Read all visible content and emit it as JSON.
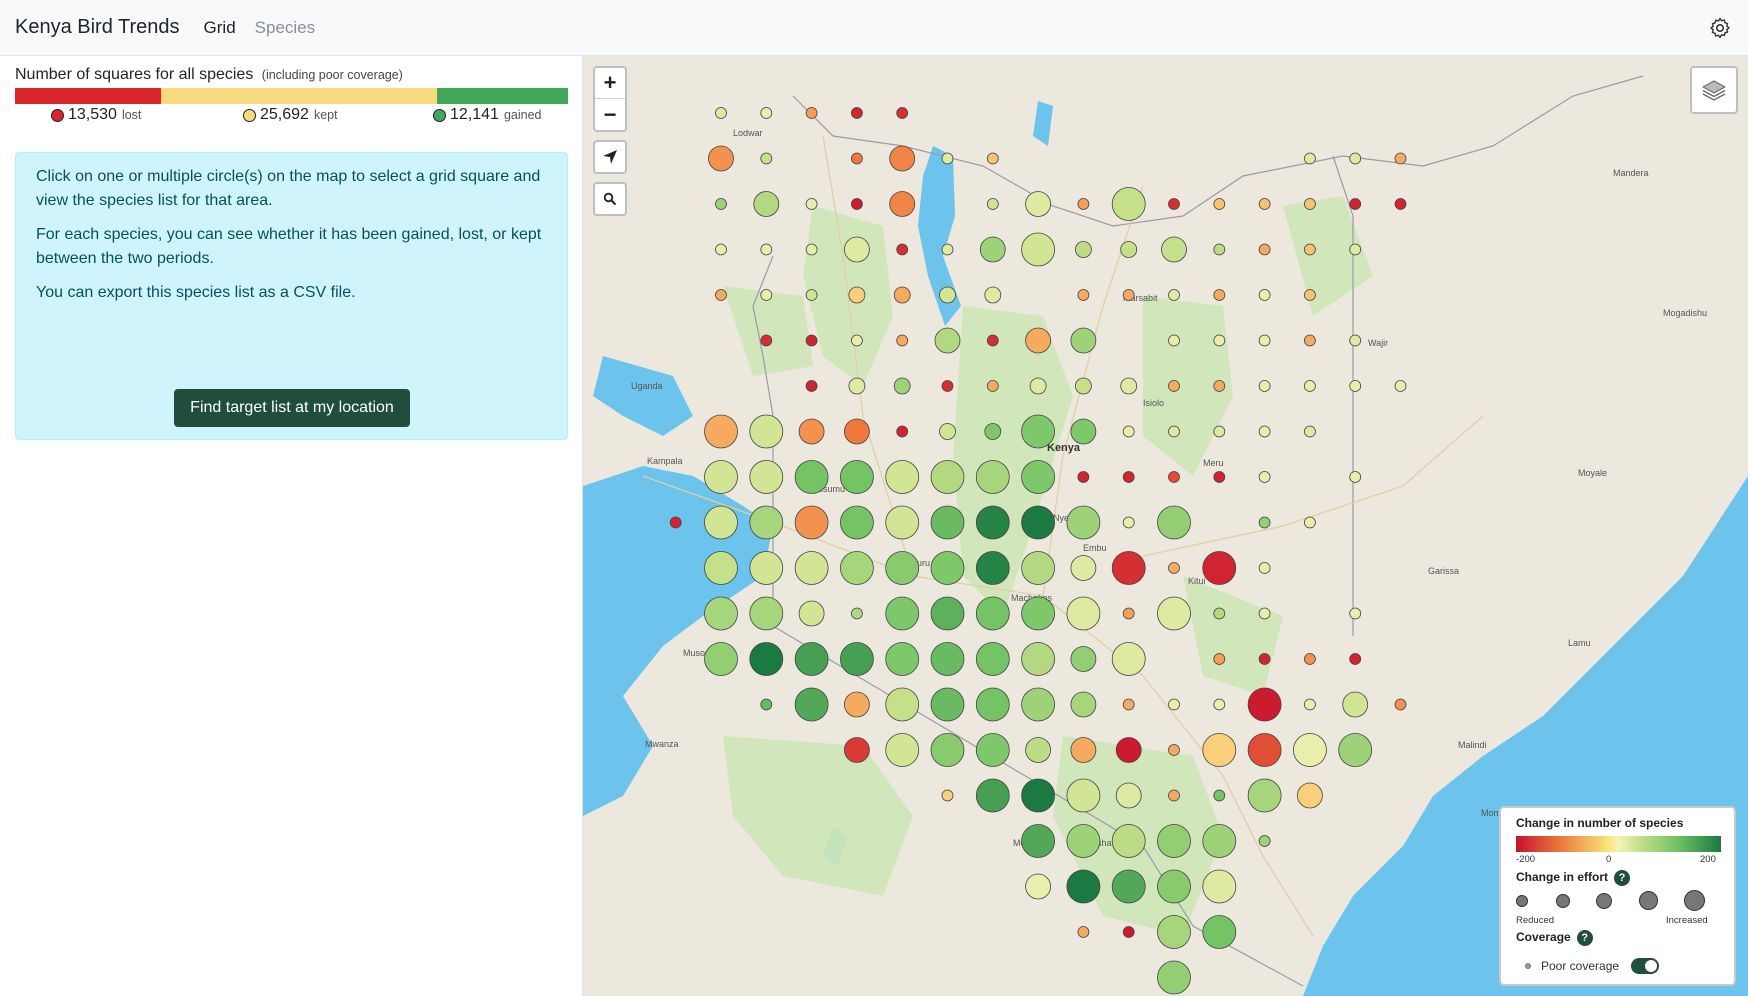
{
  "app": {
    "title": "Kenya Bird Trends"
  },
  "nav": {
    "grid": "Grid",
    "species": "Species"
  },
  "summary": {
    "title": "Number of squares for all species",
    "note": "(including poor coverage)",
    "lost": {
      "value": "13,530",
      "label": "lost",
      "color": "#d7262c"
    },
    "kept": {
      "value": "25,692",
      "label": "kept",
      "color": "#f9da7d"
    },
    "gained": {
      "value": "12,141",
      "label": "gained",
      "color": "#41a85a"
    }
  },
  "info": {
    "p1": "Click on one or multiple circle(s) on the map to select a grid square and view the species list for that area.",
    "p2": "For each species, you can see whether it has been gained, lost, or kept between the two periods.",
    "p3": "You can export this species list as a CSV file.",
    "button": "Find target list at my location"
  },
  "map_controls": {
    "zoom_in": "+",
    "zoom_out": "−"
  },
  "map_labels": {
    "country": "Kenya",
    "places": [
      "Uganda",
      "Kampala",
      "Lodwar",
      "Marsabit",
      "Wajir",
      "Garissa",
      "Mombasa",
      "Malindi",
      "Lamu",
      "Kisumu",
      "Nakuru",
      "Nyeri",
      "Embu",
      "Kitui",
      "Machakos",
      "Arusha",
      "Moshi",
      "Mwanza",
      "Musoma",
      "Moyale",
      "Mandera",
      "Isiolo",
      "Meru",
      "Mogadishu"
    ]
  },
  "legend": {
    "title_change": "Change in number of species",
    "scale_min": "-200",
    "scale_mid": "0",
    "scale_max": "200",
    "title_effort": "Change in effort",
    "effort_low": "Reduced",
    "effort_high": "Increased",
    "title_coverage": "Coverage",
    "poor_coverage": "Poor coverage",
    "help": "?"
  },
  "grid_points": [
    {
      "col": 0,
      "row": 0,
      "v": 20,
      "s": 1
    },
    {
      "col": 1,
      "row": 0,
      "v": 10,
      "s": 1
    },
    {
      "col": 2,
      "row": 0,
      "v": -70,
      "s": 1
    },
    {
      "col": 3,
      "row": 0,
      "v": -180,
      "s": 1
    },
    {
      "col": 4,
      "row": 0,
      "v": -170,
      "s": 1
    },
    {
      "col": 0,
      "row": 1,
      "v": -80,
      "s": 3
    },
    {
      "col": 1,
      "row": 1,
      "v": 40,
      "s": 1
    },
    {
      "col": 3,
      "row": 1,
      "v": -100,
      "s": 1
    },
    {
      "col": 4,
      "row": 1,
      "v": -90,
      "s": 3
    },
    {
      "col": 5,
      "row": 1,
      "v": 20,
      "s": 1
    },
    {
      "col": 6,
      "row": 1,
      "v": -40,
      "s": 1
    },
    {
      "col": 13,
      "row": 1,
      "v": 20,
      "s": 1
    },
    {
      "col": 14,
      "row": 1,
      "v": 20,
      "s": 1
    },
    {
      "col": 15,
      "row": 1,
      "v": -60,
      "s": 1
    },
    {
      "col": 0,
      "row": 2,
      "v": 80,
      "s": 1
    },
    {
      "col": 1,
      "row": 2,
      "v": 60,
      "s": 3
    },
    {
      "col": 2,
      "row": 2,
      "v": 10,
      "s": 1
    },
    {
      "col": 3,
      "row": 2,
      "v": -190,
      "s": 1
    },
    {
      "col": 4,
      "row": 2,
      "v": -90,
      "s": 3
    },
    {
      "col": 6,
      "row": 2,
      "v": 30,
      "s": 1
    },
    {
      "col": 7,
      "row": 2,
      "v": 20,
      "s": 3
    },
    {
      "col": 8,
      "row": 2,
      "v": -70,
      "s": 1
    },
    {
      "col": 9,
      "row": 2,
      "v": 40,
      "s": 4
    },
    {
      "col": 10,
      "row": 2,
      "v": -170,
      "s": 1
    },
    {
      "col": 11,
      "row": 2,
      "v": -40,
      "s": 1
    },
    {
      "col": 12,
      "row": 2,
      "v": -40,
      "s": 1
    },
    {
      "col": 13,
      "row": 2,
      "v": -40,
      "s": 1
    },
    {
      "col": 14,
      "row": 2,
      "v": -180,
      "s": 1
    },
    {
      "col": 15,
      "row": 2,
      "v": -180,
      "s": 1
    },
    {
      "col": 0,
      "row": 3,
      "v": 10,
      "s": 1
    },
    {
      "col": 1,
      "row": 3,
      "v": 10,
      "s": 1
    },
    {
      "col": 2,
      "row": 3,
      "v": 10,
      "s": 1
    },
    {
      "col": 3,
      "row": 3,
      "v": 20,
      "s": 3
    },
    {
      "col": 4,
      "row": 3,
      "v": -170,
      "s": 1
    },
    {
      "col": 5,
      "row": 3,
      "v": 20,
      "s": 1
    },
    {
      "col": 6,
      "row": 3,
      "v": 80,
      "s": 3
    },
    {
      "col": 7,
      "row": 3,
      "v": 30,
      "s": 4
    },
    {
      "col": 8,
      "row": 3,
      "v": 50,
      "s": 2
    },
    {
      "col": 9,
      "row": 3,
      "v": 40,
      "s": 2
    },
    {
      "col": 10,
      "row": 3,
      "v": 40,
      "s": 3
    },
    {
      "col": 11,
      "row": 3,
      "v": 50,
      "s": 1
    },
    {
      "col": 12,
      "row": 3,
      "v": -60,
      "s": 1
    },
    {
      "col": 13,
      "row": 3,
      "v": -40,
      "s": 1
    },
    {
      "col": 14,
      "row": 3,
      "v": 20,
      "s": 1
    },
    {
      "col": 0,
      "row": 4,
      "v": -60,
      "s": 1
    },
    {
      "col": 1,
      "row": 4,
      "v": 10,
      "s": 1
    },
    {
      "col": 2,
      "row": 4,
      "v": 30,
      "s": 1
    },
    {
      "col": 3,
      "row": 4,
      "v": -30,
      "s": 2
    },
    {
      "col": 4,
      "row": 4,
      "v": -60,
      "s": 2
    },
    {
      "col": 5,
      "row": 4,
      "v": 30,
      "s": 2
    },
    {
      "col": 6,
      "row": 4,
      "v": 20,
      "s": 2
    },
    {
      "col": 8,
      "row": 4,
      "v": -60,
      "s": 1
    },
    {
      "col": 9,
      "row": 4,
      "v": -60,
      "s": 1
    },
    {
      "col": 10,
      "row": 4,
      "v": 20,
      "s": 1
    },
    {
      "col": 11,
      "row": 4,
      "v": -60,
      "s": 1
    },
    {
      "col": 12,
      "row": 4,
      "v": 10,
      "s": 1
    },
    {
      "col": 13,
      "row": 4,
      "v": -40,
      "s": 1
    },
    {
      "col": 1,
      "row": 5,
      "v": -170,
      "s": 1
    },
    {
      "col": 2,
      "row": 5,
      "v": -180,
      "s": 1
    },
    {
      "col": 3,
      "row": 5,
      "v": 10,
      "s": 1
    },
    {
      "col": 4,
      "row": 5,
      "v": -60,
      "s": 1
    },
    {
      "col": 5,
      "row": 5,
      "v": 60,
      "s": 3
    },
    {
      "col": 6,
      "row": 5,
      "v": -170,
      "s": 1
    },
    {
      "col": 7,
      "row": 5,
      "v": -60,
      "s": 3
    },
    {
      "col": 8,
      "row": 5,
      "v": 80,
      "s": 3
    },
    {
      "col": 10,
      "row": 5,
      "v": 10,
      "s": 1
    },
    {
      "col": 11,
      "row": 5,
      "v": 10,
      "s": 1
    },
    {
      "col": 12,
      "row": 5,
      "v": 10,
      "s": 1
    },
    {
      "col": 13,
      "row": 5,
      "v": -60,
      "s": 1
    },
    {
      "col": 14,
      "row": 5,
      "v": 20,
      "s": 1
    },
    {
      "col": 2,
      "row": 6,
      "v": -180,
      "s": 1
    },
    {
      "col": 3,
      "row": 6,
      "v": 20,
      "s": 2
    },
    {
      "col": 4,
      "row": 6,
      "v": 80,
      "s": 2
    },
    {
      "col": 5,
      "row": 6,
      "v": -170,
      "s": 1
    },
    {
      "col": 6,
      "row": 6,
      "v": -60,
      "s": 1
    },
    {
      "col": 7,
      "row": 6,
      "v": 20,
      "s": 2
    },
    {
      "col": 8,
      "row": 6,
      "v": 40,
      "s": 2
    },
    {
      "col": 9,
      "row": 6,
      "v": 20,
      "s": 2
    },
    {
      "col": 10,
      "row": 6,
      "v": -60,
      "s": 1
    },
    {
      "col": 11,
      "row": 6,
      "v": -60,
      "s": 1
    },
    {
      "col": 12,
      "row": 6,
      "v": 10,
      "s": 1
    },
    {
      "col": 13,
      "row": 6,
      "v": 10,
      "s": 1
    },
    {
      "col": 14,
      "row": 6,
      "v": 10,
      "s": 1
    },
    {
      "col": 15,
      "row": 6,
      "v": 10,
      "s": 1
    },
    {
      "col": 0,
      "row": 7,
      "v": -60,
      "s": 4
    },
    {
      "col": 1,
      "row": 7,
      "v": 30,
      "s": 4
    },
    {
      "col": 2,
      "row": 7,
      "v": -80,
      "s": 3
    },
    {
      "col": 3,
      "row": 7,
      "v": -100,
      "s": 3
    },
    {
      "col": 4,
      "row": 7,
      "v": -180,
      "s": 1
    },
    {
      "col": 5,
      "row": 7,
      "v": 30,
      "s": 2
    },
    {
      "col": 6,
      "row": 7,
      "v": 110,
      "s": 2
    },
    {
      "col": 7,
      "row": 7,
      "v": 110,
      "s": 4
    },
    {
      "col": 8,
      "row": 7,
      "v": 110,
      "s": 3
    },
    {
      "col": 9,
      "row": 7,
      "v": 10,
      "s": 1
    },
    {
      "col": 10,
      "row": 7,
      "v": 20,
      "s": 1
    },
    {
      "col": 11,
      "row": 7,
      "v": 20,
      "s": 1
    },
    {
      "col": 12,
      "row": 7,
      "v": 10,
      "s": 1
    },
    {
      "col": 13,
      "row": 7,
      "v": 20,
      "s": 1
    },
    {
      "col": 0,
      "row": 8,
      "v": 30,
      "s": 4
    },
    {
      "col": 1,
      "row": 8,
      "v": 30,
      "s": 4
    },
    {
      "col": 2,
      "row": 8,
      "v": 120,
      "s": 4
    },
    {
      "col": 3,
      "row": 8,
      "v": 120,
      "s": 4
    },
    {
      "col": 4,
      "row": 8,
      "v": 30,
      "s": 4
    },
    {
      "col": 5,
      "row": 8,
      "v": 60,
      "s": 4
    },
    {
      "col": 6,
      "row": 8,
      "v": 70,
      "s": 4
    },
    {
      "col": 7,
      "row": 8,
      "v": 110,
      "s": 4
    },
    {
      "col": 8,
      "row": 8,
      "v": -180,
      "s": 1
    },
    {
      "col": 9,
      "row": 8,
      "v": -180,
      "s": 1
    },
    {
      "col": 10,
      "row": 8,
      "v": -140,
      "s": 1
    },
    {
      "col": 11,
      "row": 8,
      "v": -180,
      "s": 1
    },
    {
      "col": 12,
      "row": 8,
      "v": 10,
      "s": 1
    },
    {
      "col": 14,
      "row": 8,
      "v": 10,
      "s": 1
    },
    {
      "col": -1,
      "row": 9,
      "v": -180,
      "s": 1
    },
    {
      "col": 0,
      "row": 9,
      "v": 30,
      "s": 4
    },
    {
      "col": 1,
      "row": 9,
      "v": 70,
      "s": 4
    },
    {
      "col": 2,
      "row": 9,
      "v": -80,
      "s": 4
    },
    {
      "col": 3,
      "row": 9,
      "v": 120,
      "s": 4
    },
    {
      "col": 4,
      "row": 9,
      "v": 30,
      "s": 4
    },
    {
      "col": 5,
      "row": 9,
      "v": 130,
      "s": 4
    },
    {
      "col": 6,
      "row": 9,
      "v": 190,
      "s": 4
    },
    {
      "col": 7,
      "row": 9,
      "v": 200,
      "s": 4
    },
    {
      "col": 8,
      "row": 9,
      "v": 80,
      "s": 4
    },
    {
      "col": 9,
      "row": 9,
      "v": 10,
      "s": 1
    },
    {
      "col": 10,
      "row": 9,
      "v": 90,
      "s": 4
    },
    {
      "col": 12,
      "row": 9,
      "v": 90,
      "s": 1
    },
    {
      "col": 13,
      "row": 9,
      "v": 10,
      "s": 1
    },
    {
      "col": 0,
      "row": 10,
      "v": 40,
      "s": 4
    },
    {
      "col": 1,
      "row": 10,
      "v": 30,
      "s": 4
    },
    {
      "col": 2,
      "row": 10,
      "v": 30,
      "s": 4
    },
    {
      "col": 3,
      "row": 10,
      "v": 70,
      "s": 4
    },
    {
      "col": 4,
      "row": 10,
      "v": 100,
      "s": 4
    },
    {
      "col": 5,
      "row": 10,
      "v": 110,
      "s": 4
    },
    {
      "col": 6,
      "row": 10,
      "v": 190,
      "s": 4
    },
    {
      "col": 7,
      "row": 10,
      "v": 60,
      "s": 4
    },
    {
      "col": 8,
      "row": 10,
      "v": 20,
      "s": 3
    },
    {
      "col": 9,
      "row": 10,
      "v": -170,
      "s": 4
    },
    {
      "col": 10,
      "row": 10,
      "v": -60,
      "s": 1
    },
    {
      "col": 11,
      "row": 10,
      "v": -180,
      "s": 4
    },
    {
      "col": 12,
      "row": 10,
      "v": 10,
      "s": 1
    },
    {
      "col": 0,
      "row": 11,
      "v": 70,
      "s": 4
    },
    {
      "col": 1,
      "row": 11,
      "v": 70,
      "s": 4
    },
    {
      "col": 2,
      "row": 11,
      "v": 30,
      "s": 3
    },
    {
      "col": 3,
      "row": 11,
      "v": 60,
      "s": 1
    },
    {
      "col": 4,
      "row": 11,
      "v": 110,
      "s": 4
    },
    {
      "col": 5,
      "row": 11,
      "v": 140,
      "s": 4
    },
    {
      "col": 6,
      "row": 11,
      "v": 120,
      "s": 4
    },
    {
      "col": 7,
      "row": 11,
      "v": 110,
      "s": 4
    },
    {
      "col": 8,
      "row": 11,
      "v": 20,
      "s": 4
    },
    {
      "col": 9,
      "row": 11,
      "v": -70,
      "s": 1
    },
    {
      "col": 10,
      "row": 11,
      "v": 20,
      "s": 4
    },
    {
      "col": 11,
      "row": 11,
      "v": 60,
      "s": 1
    },
    {
      "col": 12,
      "row": 11,
      "v": 10,
      "s": 1
    },
    {
      "col": 14,
      "row": 11,
      "v": 10,
      "s": 1
    },
    {
      "col": 0,
      "row": 12,
      "v": 90,
      "s": 4
    },
    {
      "col": 1,
      "row": 12,
      "v": 200,
      "s": 4
    },
    {
      "col": 2,
      "row": 12,
      "v": 160,
      "s": 4
    },
    {
      "col": 3,
      "row": 12,
      "v": 160,
      "s": 4
    },
    {
      "col": 4,
      "row": 12,
      "v": 110,
      "s": 4
    },
    {
      "col": 5,
      "row": 12,
      "v": 130,
      "s": 4
    },
    {
      "col": 6,
      "row": 12,
      "v": 120,
      "s": 4
    },
    {
      "col": 7,
      "row": 12,
      "v": 60,
      "s": 4
    },
    {
      "col": 8,
      "row": 12,
      "v": 90,
      "s": 3
    },
    {
      "col": 9,
      "row": 12,
      "v": 20,
      "s": 4
    },
    {
      "col": 11,
      "row": 12,
      "v": -70,
      "s": 1
    },
    {
      "col": 12,
      "row": 12,
      "v": -180,
      "s": 1
    },
    {
      "col": 13,
      "row": 12,
      "v": -80,
      "s": 1
    },
    {
      "col": 14,
      "row": 12,
      "v": -180,
      "s": 1
    },
    {
      "col": 1,
      "row": 13,
      "v": 130,
      "s": 1
    },
    {
      "col": 2,
      "row": 13,
      "v": 150,
      "s": 4
    },
    {
      "col": 3,
      "row": 13,
      "v": -60,
      "s": 3
    },
    {
      "col": 4,
      "row": 13,
      "v": 40,
      "s": 4
    },
    {
      "col": 5,
      "row": 13,
      "v": 130,
      "s": 4
    },
    {
      "col": 6,
      "row": 13,
      "v": 120,
      "s": 4
    },
    {
      "col": 7,
      "row": 13,
      "v": 80,
      "s": 4
    },
    {
      "col": 8,
      "row": 13,
      "v": 70,
      "s": 3
    },
    {
      "col": 9,
      "row": 13,
      "v": -60,
      "s": 1
    },
    {
      "col": 10,
      "row": 13,
      "v": 10,
      "s": 1
    },
    {
      "col": 11,
      "row": 13,
      "v": 10,
      "s": 1
    },
    {
      "col": 12,
      "row": 13,
      "v": -190,
      "s": 4
    },
    {
      "col": 13,
      "row": 13,
      "v": 10,
      "s": 1
    },
    {
      "col": 14,
      "row": 13,
      "v": 30,
      "s": 3
    },
    {
      "col": 15,
      "row": 13,
      "v": -80,
      "s": 1
    },
    {
      "col": 3,
      "row": 14,
      "v": -160,
      "s": 3
    },
    {
      "col": 4,
      "row": 14,
      "v": 30,
      "s": 4
    },
    {
      "col": 5,
      "row": 14,
      "v": 100,
      "s": 4
    },
    {
      "col": 6,
      "row": 14,
      "v": 110,
      "s": 4
    },
    {
      "col": 7,
      "row": 14,
      "v": 50,
      "s": 3
    },
    {
      "col": 8,
      "row": 14,
      "v": -60,
      "s": 3
    },
    {
      "col": 9,
      "row": 14,
      "v": -190,
      "s": 3
    },
    {
      "col": 10,
      "row": 14,
      "v": -60,
      "s": 1
    },
    {
      "col": 11,
      "row": 14,
      "v": -30,
      "s": 4
    },
    {
      "col": 12,
      "row": 14,
      "v": -140,
      "s": 4
    },
    {
      "col": 13,
      "row": 14,
      "v": 10,
      "s": 4
    },
    {
      "col": 14,
      "row": 14,
      "v": 80,
      "s": 4
    },
    {
      "col": 5,
      "row": 15,
      "v": -30,
      "s": 1
    },
    {
      "col": 6,
      "row": 15,
      "v": 160,
      "s": 4
    },
    {
      "col": 7,
      "row": 15,
      "v": 210,
      "s": 4
    },
    {
      "col": 8,
      "row": 15,
      "v": 30,
      "s": 4
    },
    {
      "col": 9,
      "row": 15,
      "v": 20,
      "s": 3
    },
    {
      "col": 10,
      "row": 15,
      "v": -60,
      "s": 1
    },
    {
      "col": 11,
      "row": 15,
      "v": 120,
      "s": 1
    },
    {
      "col": 12,
      "row": 15,
      "v": 70,
      "s": 4
    },
    {
      "col": 13,
      "row": 15,
      "v": -30,
      "s": 3
    },
    {
      "col": 7,
      "row": 16,
      "v": 150,
      "s": 4
    },
    {
      "col": 8,
      "row": 16,
      "v": 80,
      "s": 4
    },
    {
      "col": 9,
      "row": 16,
      "v": 50,
      "s": 4
    },
    {
      "col": 10,
      "row": 16,
      "v": 90,
      "s": 4
    },
    {
      "col": 11,
      "row": 16,
      "v": 80,
      "s": 4
    },
    {
      "col": 12,
      "row": 16,
      "v": 80,
      "s": 1
    },
    {
      "col": 7,
      "row": 17,
      "v": 10,
      "s": 3
    },
    {
      "col": 8,
      "row": 17,
      "v": 210,
      "s": 4
    },
    {
      "col": 9,
      "row": 17,
      "v": 150,
      "s": 4
    },
    {
      "col": 10,
      "row": 17,
      "v": 100,
      "s": 4
    },
    {
      "col": 11,
      "row": 17,
      "v": 20,
      "s": 4
    },
    {
      "col": 8,
      "row": 18,
      "v": -60,
      "s": 1
    },
    {
      "col": 9,
      "row": 18,
      "v": -190,
      "s": 1
    },
    {
      "col": 10,
      "row": 18,
      "v": 70,
      "s": 4
    },
    {
      "col": 11,
      "row": 18,
      "v": 120,
      "s": 4
    },
    {
      "col": 10,
      "row": 19,
      "v": 90,
      "s": 4
    }
  ]
}
